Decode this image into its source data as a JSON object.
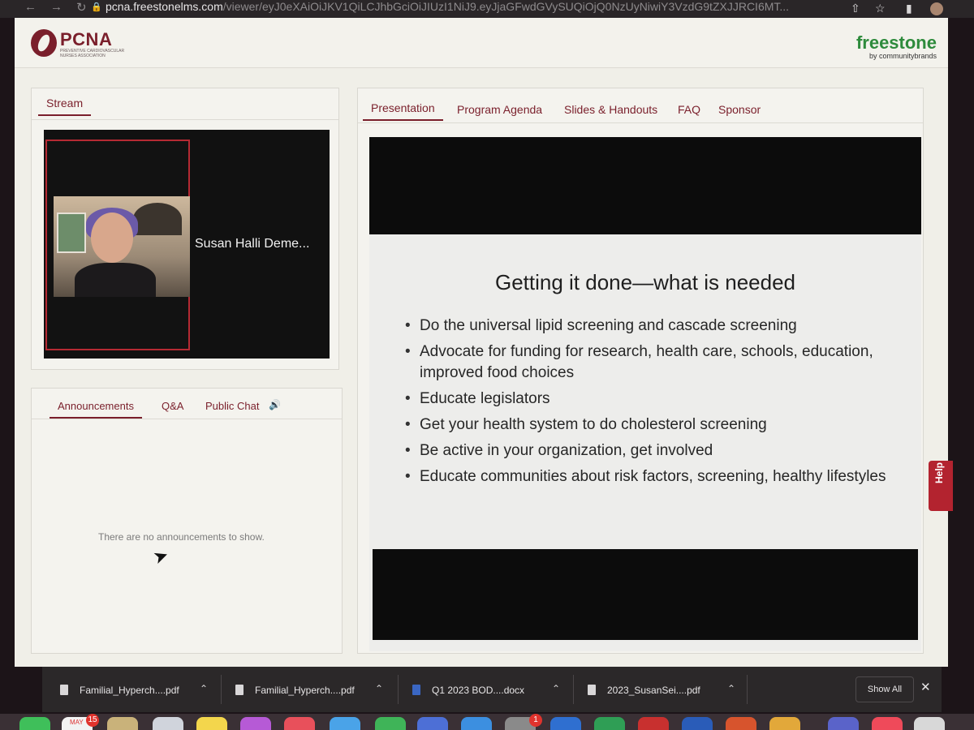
{
  "browser": {
    "url_host": "pcna.freestonelms.com",
    "url_path": "/viewer/eyJ0eXAiOiJKV1QiLCJhbGciOiJIUzI1NiJ9.eyJjaGFwdGVySUQiOjQ0NzUyNiwiY3VzdG9tZXJJRCI6MT..."
  },
  "header": {
    "logo_text": "PCNA",
    "logo_subtext": "Preventive Cardiovascular Nurses Association",
    "partner_name": "freestone",
    "partner_by": "by communitybrands"
  },
  "stream": {
    "tab_label": "Stream",
    "speaker_name": "Susan Halli Deme..."
  },
  "chat": {
    "tabs": [
      "Announcements",
      "Q&A",
      "Public Chat"
    ],
    "empty_message": "There are no announcements to show."
  },
  "presentation": {
    "tabs": [
      "Presentation",
      "Program Agenda",
      "Slides & Handouts",
      "FAQ",
      "Sponsor"
    ],
    "slide_title": "Getting it done—what is needed",
    "bullets": [
      "Do the universal lipid screening and cascade screening",
      "Advocate for funding for research, health care, schools, education, improved food choices",
      "Educate legislators",
      "Get your health system to do cholesterol screening",
      "Be active in your organization, get involved",
      "Educate communities about risk factors, screening, healthy lifestyles"
    ]
  },
  "help": {
    "label": "Help"
  },
  "downloads": {
    "items": [
      {
        "name": "Familial_Hyperch....pdf"
      },
      {
        "name": "Familial_Hyperch....pdf"
      },
      {
        "name": "Q1 2023 BOD....docx"
      },
      {
        "name": "2023_SusanSei....pdf"
      }
    ],
    "show_all": "Show All"
  },
  "dock": {
    "calendar_month": "MAY",
    "calendar_badge": "15",
    "app_badge": "1"
  },
  "colors": {
    "brand": "#7a1f2b",
    "help": "#b3232f",
    "partner": "#2e8b3c"
  }
}
